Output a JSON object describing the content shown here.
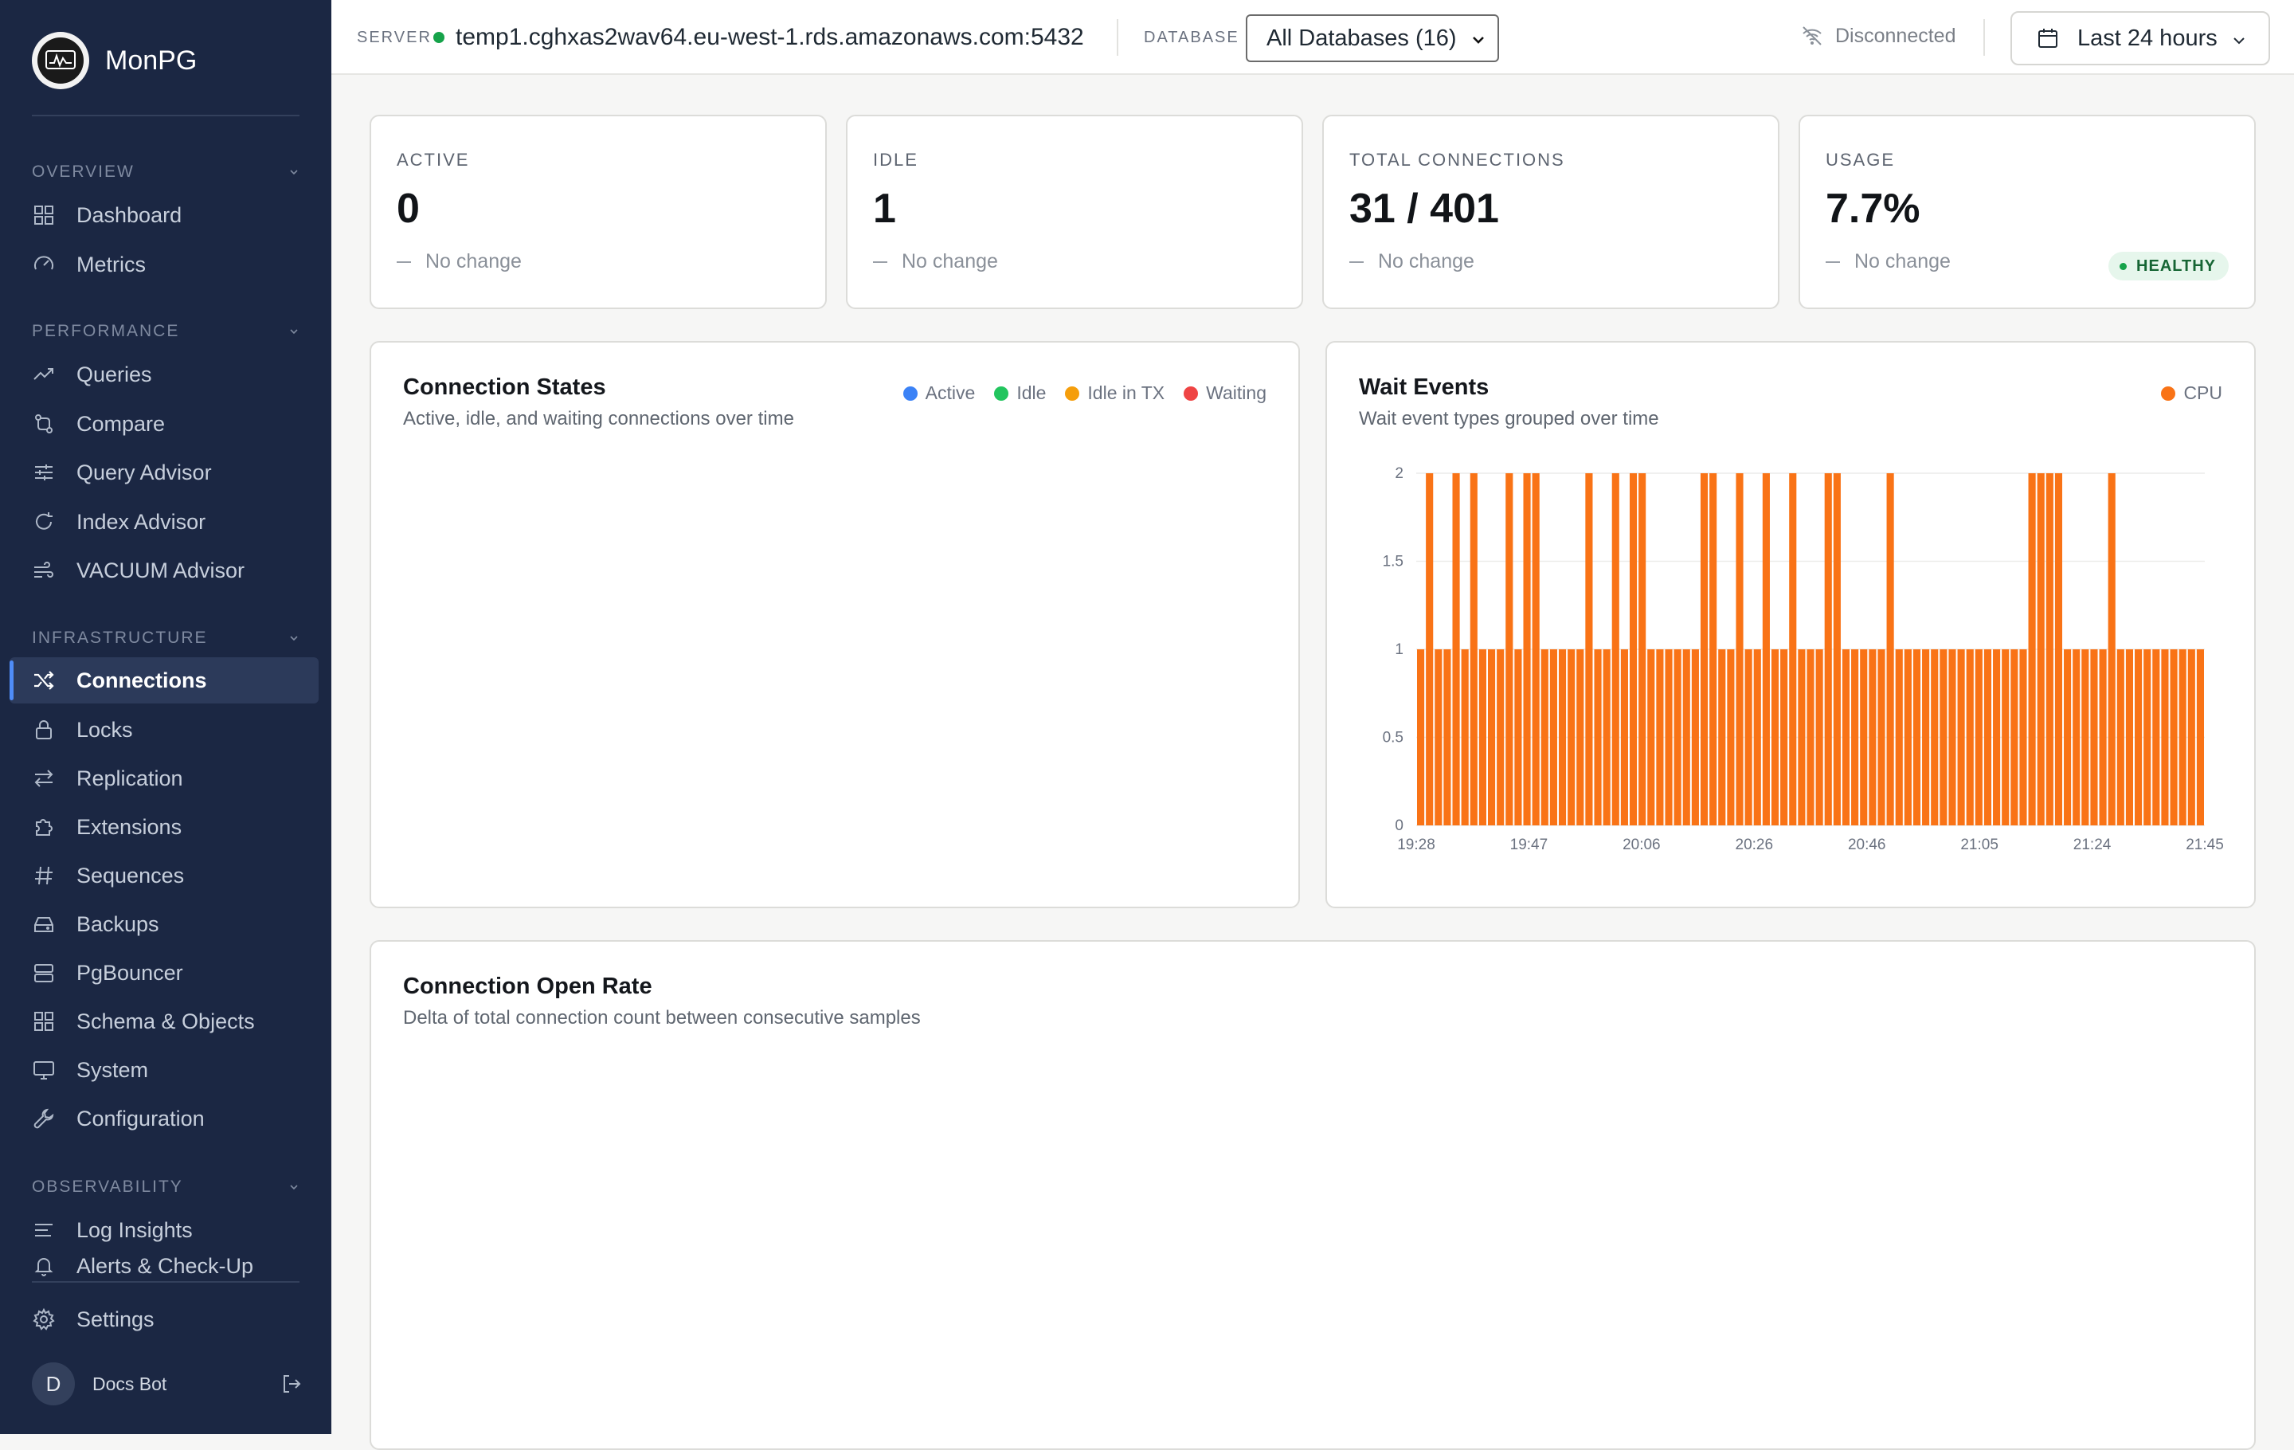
{
  "app": {
    "name": "MonPG"
  },
  "sidebar": {
    "sections": [
      {
        "title": "OVERVIEW",
        "items": [
          {
            "label": "Dashboard",
            "icon": "dashboard-icon"
          },
          {
            "label": "Metrics",
            "icon": "gauge-icon"
          }
        ]
      },
      {
        "title": "PERFORMANCE",
        "items": [
          {
            "label": "Queries",
            "icon": "trend-icon"
          },
          {
            "label": "Compare",
            "icon": "compare-icon"
          },
          {
            "label": "Query Advisor",
            "icon": "sliders-icon"
          },
          {
            "label": "Index Advisor",
            "icon": "refresh-icon"
          },
          {
            "label": "VACUUM Advisor",
            "icon": "wind-icon"
          }
        ]
      },
      {
        "title": "INFRASTRUCTURE",
        "items": [
          {
            "label": "Connections",
            "icon": "shuffle-icon"
          },
          {
            "label": "Locks",
            "icon": "lock-icon"
          },
          {
            "label": "Replication",
            "icon": "arrows-icon"
          },
          {
            "label": "Extensions",
            "icon": "puzzle-icon"
          },
          {
            "label": "Sequences",
            "icon": "hash-icon"
          },
          {
            "label": "Backups",
            "icon": "drive-icon"
          },
          {
            "label": "PgBouncer",
            "icon": "server-icon"
          },
          {
            "label": "Schema & Objects",
            "icon": "grid-icon"
          },
          {
            "label": "System",
            "icon": "monitor-icon"
          },
          {
            "label": "Configuration",
            "icon": "wrench-icon"
          }
        ]
      },
      {
        "title": "OBSERVABILITY",
        "items": [
          {
            "label": "Log Insights",
            "icon": "lines-icon"
          },
          {
            "label": "Alerts & Check-Up",
            "icon": "bell-icon"
          }
        ]
      }
    ],
    "active_item": "Connections",
    "settings_label": "Settings",
    "user": {
      "initial": "D",
      "name": "Docs Bot"
    }
  },
  "topbar": {
    "server_label": "SERVER",
    "server_host": "temp1.cghxas2wav64.eu-west-1.rds.amazonaws.com:5432",
    "database_label": "DATABASE",
    "database_selected": "All Databases (16)",
    "status": "Disconnected",
    "time_range": "Last 24 hours"
  },
  "stats": [
    {
      "label": "ACTIVE",
      "value": "0",
      "delta": "No change"
    },
    {
      "label": "IDLE",
      "value": "1",
      "delta": "No change"
    },
    {
      "label": "TOTAL CONNECTIONS",
      "value": "31 / 401",
      "delta": "No change"
    },
    {
      "label": "USAGE",
      "value": "7.7%",
      "delta": "No change",
      "badge": "HEALTHY"
    }
  ],
  "charts": {
    "states": {
      "title": "Connection States",
      "subtitle": "Active, idle, and waiting connections over time",
      "legend": [
        {
          "name": "Active",
          "color": "#3b82f6"
        },
        {
          "name": "Idle",
          "color": "#22c55e"
        },
        {
          "name": "Idle in TX",
          "color": "#f59e0b"
        },
        {
          "name": "Waiting",
          "color": "#ef4444"
        }
      ]
    },
    "wait": {
      "title": "Wait Events",
      "subtitle": "Wait event types grouped over time",
      "legend": [
        {
          "name": "CPU",
          "color": "#f97316"
        }
      ]
    },
    "open_rate": {
      "title": "Connection Open Rate",
      "subtitle": "Delta of total connection count between consecutive samples"
    }
  },
  "chart_data": {
    "type": "bar",
    "title": "Wait Events",
    "series": [
      {
        "name": "CPU",
        "color": "#f97316",
        "values": [
          1,
          2,
          1,
          1,
          2,
          1,
          2,
          1,
          1,
          1,
          2,
          1,
          2,
          2,
          1,
          1,
          1,
          1,
          1,
          2,
          1,
          1,
          2,
          1,
          2,
          2,
          1,
          1,
          1,
          1,
          1,
          1,
          2,
          2,
          1,
          1,
          2,
          1,
          1,
          2,
          1,
          1,
          2,
          1,
          1,
          1,
          2,
          2,
          1,
          1,
          1,
          1,
          1,
          2,
          1,
          1,
          1,
          1,
          1,
          1,
          1,
          1,
          1,
          1,
          1,
          1,
          1,
          1,
          1,
          2,
          2,
          2,
          2,
          1,
          1,
          1,
          1,
          1,
          2,
          1,
          1,
          1,
          1,
          1,
          1,
          1,
          1,
          1,
          1
        ]
      }
    ],
    "x_ticks": [
      "19:28",
      "19:47",
      "20:06",
      "20:26",
      "20:46",
      "21:05",
      "21:24",
      "21:45"
    ],
    "y_ticks": [
      "0",
      "0.5",
      "1",
      "1.5",
      "2"
    ],
    "ylim": [
      0,
      2
    ],
    "grid": true,
    "legend_position": "top-right"
  }
}
